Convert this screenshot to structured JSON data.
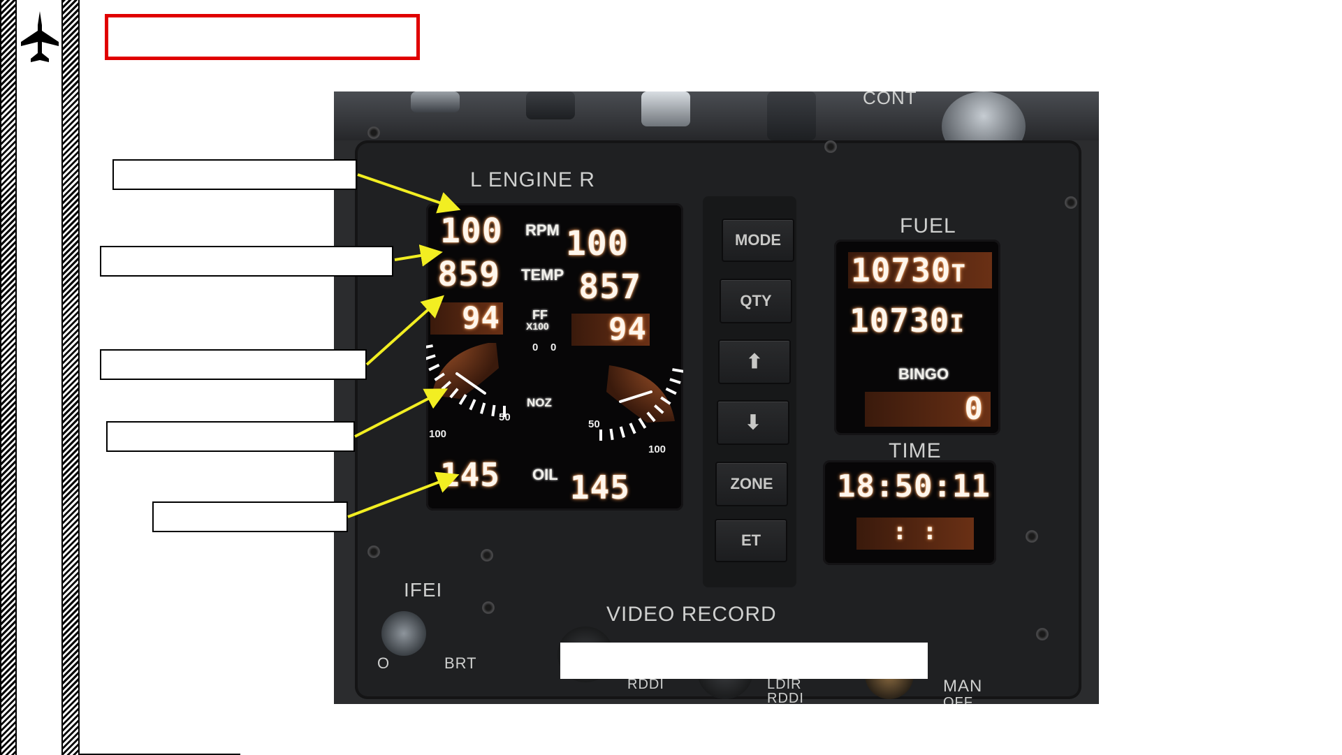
{
  "panel": {
    "engine_title": "L  ENGINE  R",
    "fuel_title": "FUEL",
    "time_title": "TIME",
    "ifei_label": "IFEI",
    "brt_label": "BRT",
    "video_record_label": "VIDEO RECORD",
    "cont_label": "CONT",
    "man_label": "MAN",
    "off_label": "OFF",
    "rddi_label": "RDDI",
    "ldir_label": "LDIR",
    "rddi_label2": "RDDI",
    "o_label": "O"
  },
  "engine": {
    "rpm_label": "RPM",
    "temp_label": "TEMP",
    "ff_label": "FF",
    "ff_unit": "X100",
    "noz_label": "NOZ",
    "oil_label": "OIL",
    "rpm_left": "100",
    "rpm_right": "100",
    "temp_left": "859",
    "temp_right": "857",
    "ff_left": "94",
    "ff_right": "94",
    "oil_left": "145",
    "oil_right": "145",
    "noz_left_percent": 20,
    "noz_right_percent": 20,
    "noz_ticks": {
      "zero": "0",
      "fifty": "50",
      "hundred": "100"
    }
  },
  "buttons": {
    "mode": "MODE",
    "qty": "QTY",
    "up": "⬆",
    "down": "⬇",
    "zone": "ZONE",
    "et": "ET"
  },
  "fuel": {
    "internal": "10730",
    "internal_suffix": "T",
    "total": "10730",
    "total_suffix": "I",
    "bingo_label": "BINGO",
    "bingo_value": "0"
  },
  "time": {
    "clock": "18:50:11",
    "elapsed": ":    :"
  },
  "colors": {
    "arrow": "#f2ee22",
    "title_box_border": "#e00000",
    "segment_glow": "#ff9e5a"
  }
}
